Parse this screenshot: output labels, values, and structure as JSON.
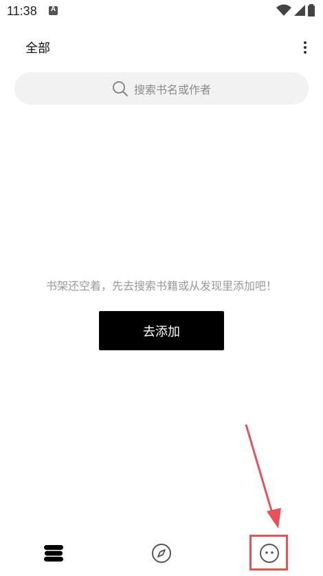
{
  "status_bar": {
    "time": "11:38"
  },
  "header": {
    "title": "全部"
  },
  "search": {
    "placeholder": "搜索书名或作者"
  },
  "empty_state": {
    "message": "书架还空着，先去搜索书籍或从发现里添加吧！",
    "button_label": "去添加"
  },
  "bottom_nav": {
    "items": [
      {
        "id": "bookshelf",
        "icon": "bookshelf-icon",
        "active": true
      },
      {
        "id": "discover",
        "icon": "compass-icon",
        "active": false
      },
      {
        "id": "mine",
        "icon": "smiley-face-icon",
        "active": false
      }
    ]
  },
  "colors": {
    "background": "#ffffff",
    "primary": "#000000",
    "search_bg": "#f2f2f2",
    "muted_text": "#9a9a9a",
    "annotation": "#e8515a"
  }
}
